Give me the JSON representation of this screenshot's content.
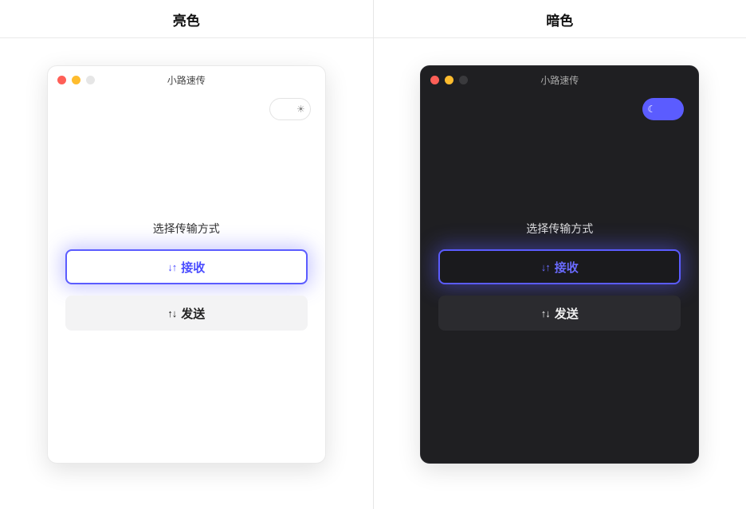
{
  "panes": {
    "light": {
      "pane_title": "亮色",
      "window_title": "小路速传",
      "theme_toggle_glyph": "☀",
      "prompt": "选择传输方式",
      "receive_glyph": "↓↑",
      "receive_label": "接收",
      "send_glyph": "↑↓",
      "send_label": "发送"
    },
    "dark": {
      "pane_title": "暗色",
      "window_title": "小路速传",
      "theme_toggle_glyph": "☾",
      "prompt": "选择传输方式",
      "receive_glyph": "↓↑",
      "receive_label": "接收",
      "send_glyph": "↑↓",
      "send_label": "发送"
    }
  },
  "colors": {
    "accent": "#5b5cff",
    "dark_bg": "#1f1f22"
  }
}
